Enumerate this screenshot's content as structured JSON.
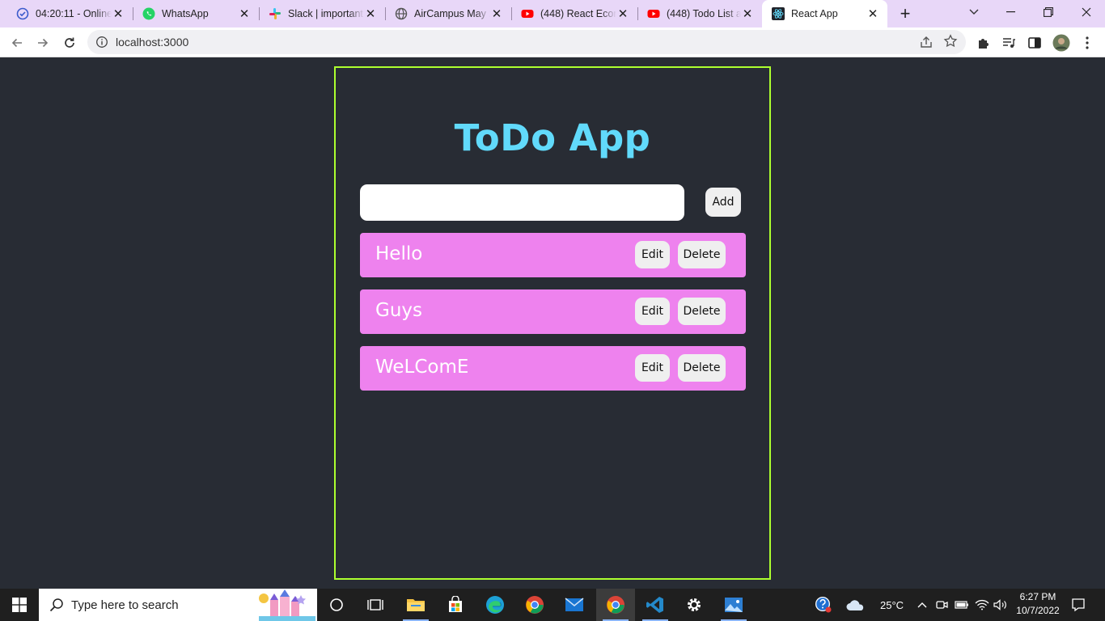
{
  "browser": {
    "tabs": [
      {
        "title": "04:20:11 - Online",
        "icon": "check-circle-icon"
      },
      {
        "title": "WhatsApp",
        "icon": "whatsapp-icon"
      },
      {
        "title": "Slack | important",
        "icon": "slack-icon"
      },
      {
        "title": "AirCampus May 2",
        "icon": "globe-icon"
      },
      {
        "title": "(448) React Ecom",
        "icon": "youtube-icon"
      },
      {
        "title": "(448) Todo List ap",
        "icon": "youtube-icon"
      },
      {
        "title": "React App",
        "icon": "react-icon"
      }
    ],
    "url": "localhost:3000"
  },
  "app": {
    "title": "ToDo App",
    "input_value": "",
    "add_label": "Add",
    "edit_label": "Edit",
    "delete_label": "Delete",
    "todos": [
      "Hello",
      "Guys",
      "WeLComE"
    ],
    "accent_colors": {
      "title": "#61dafb",
      "item_bg": "#ee82ee",
      "border": "#adff2f",
      "page_bg": "#282c34"
    }
  },
  "taskbar": {
    "search_placeholder": "Type here to search",
    "weather": "25°C",
    "time": "6:27 PM",
    "date": "10/7/2022"
  }
}
